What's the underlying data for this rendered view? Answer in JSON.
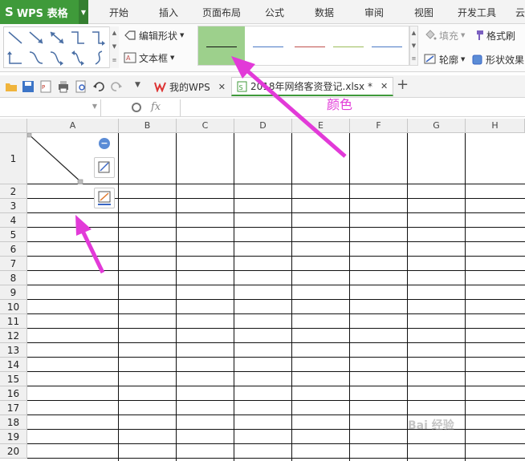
{
  "app": {
    "name": "WPS 表格",
    "logo": "S"
  },
  "menu": [
    "开始",
    "插入",
    "页面布局",
    "公式",
    "数据",
    "审阅",
    "视图",
    "开发工具",
    "云"
  ],
  "ribbon": {
    "edit_shape": "编辑形状",
    "text_box": "文本框",
    "fill": "填充",
    "format_painter": "格式刷",
    "outline": "轮廓",
    "shape_effects": "形状效果",
    "line_colors": [
      "#111111",
      "#4a78c4",
      "#c0504d",
      "#9bbb59",
      "#4a78c4"
    ]
  },
  "tabs": {
    "home": "我的WPS",
    "document": "2018年网络客资登记.xlsx *"
  },
  "formula_bar": {
    "name_value": "",
    "fx": "fx",
    "formula_value": ""
  },
  "sheet": {
    "columns": [
      "A",
      "B",
      "C",
      "D",
      "E",
      "F",
      "G",
      "H"
    ],
    "rows": [
      "1",
      "2",
      "3",
      "4",
      "5",
      "6",
      "7",
      "8",
      "9",
      "10",
      "11",
      "12",
      "13",
      "14",
      "15",
      "16",
      "17",
      "18",
      "19",
      "20"
    ]
  },
  "annotation": {
    "label": "颜色",
    "color": "#e23ad8"
  },
  "watermark": "Bai 经验"
}
